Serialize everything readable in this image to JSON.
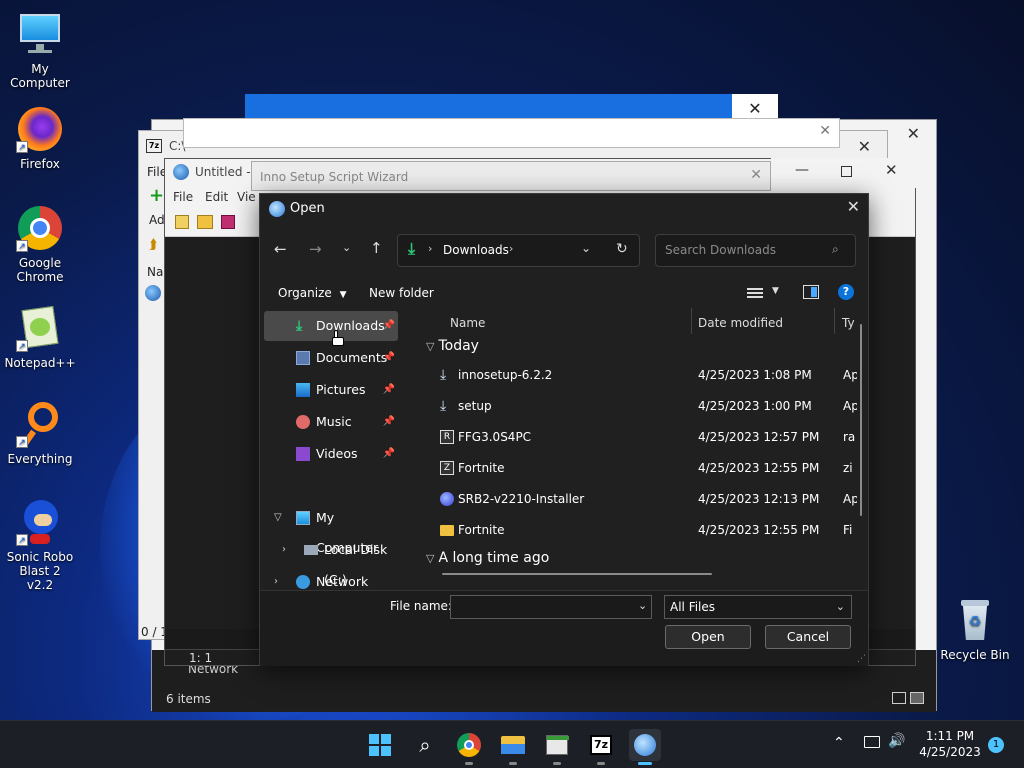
{
  "desktop": {
    "icons": [
      {
        "label": "My Computer"
      },
      {
        "label": "Firefox"
      },
      {
        "label": "Google Chrome"
      },
      {
        "label": "Notepad++"
      },
      {
        "label": "Everything"
      },
      {
        "label": "Sonic Robo Blast 2 v2.2"
      },
      {
        "label": "Recycle Bin"
      }
    ]
  },
  "bg_windows": {
    "sevenzip": {
      "title_partial": "C:\\",
      "menu_partial": "File",
      "add_partial": "Ad",
      "name_partial": "Nam",
      "status_partial": "0 / 1"
    },
    "notepad": {
      "title": "Untitled - I",
      "menu": [
        "File",
        "Edit",
        "Vie"
      ],
      "status": "1:  1"
    },
    "explorer": {
      "status": "6 items",
      "network": "Network"
    },
    "wizard": {
      "title": "Inno Setup Script Wizard"
    }
  },
  "dialog": {
    "title": "Open",
    "address": {
      "location": "Downloads"
    },
    "search_placeholder": "Search Downloads",
    "toolbar": {
      "organize": "Organize",
      "new_folder": "New folder"
    },
    "nav": [
      {
        "label": "Downloads",
        "pinned": true
      },
      {
        "label": "Documents",
        "pinned": true
      },
      {
        "label": "Pictures",
        "pinned": true
      },
      {
        "label": "Music",
        "pinned": true
      },
      {
        "label": "Videos",
        "pinned": true
      },
      {
        "label": "My Computer"
      },
      {
        "label": "Local Disk (C:)"
      },
      {
        "label": "Network"
      }
    ],
    "columns": {
      "name": "Name",
      "date": "Date modified",
      "type": "Ty"
    },
    "groups": {
      "today": "Today",
      "older": "A long time ago"
    },
    "files": [
      {
        "name": "innosetup-6.2.2",
        "date": "4/25/2023 1:08 PM",
        "type": "Ap",
        "icon": "installer-icon"
      },
      {
        "name": "setup",
        "date": "4/25/2023 1:00 PM",
        "type": "Ap",
        "icon": "installer-icon"
      },
      {
        "name": "FFG3.0S4PC",
        "date": "4/25/2023 12:57 PM",
        "type": "ra",
        "icon": "archive-icon"
      },
      {
        "name": "Fortnite",
        "date": "4/25/2023 12:55 PM",
        "type": "zi",
        "icon": "archive-icon"
      },
      {
        "name": "SRB2-v2210-Installer",
        "date": "4/25/2023 12:13 PM",
        "type": "Ap",
        "icon": "app-icon"
      },
      {
        "name": "Fortnite",
        "date": "4/25/2023 12:55 PM",
        "type": "Fi",
        "icon": "folder-icon"
      }
    ],
    "filename_label": "File name:",
    "filename_value": "",
    "filter": "All Files",
    "open_button": "Open",
    "cancel_button": "Cancel"
  },
  "taskbar": {
    "time": "1:11 PM",
    "date": "4/25/2023",
    "notification_count": "1"
  },
  "colors": {
    "accent": "#0a74d9",
    "dialog_bg": "#202020",
    "selection": "#4a4a4a"
  }
}
